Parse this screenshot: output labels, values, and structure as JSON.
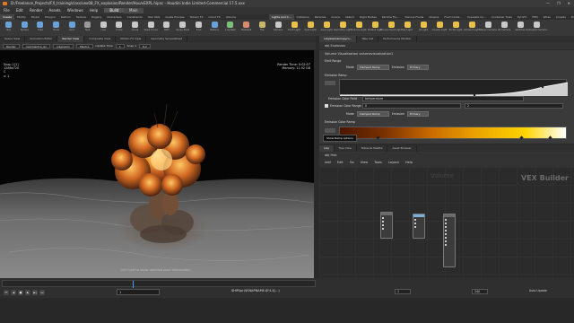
{
  "window": {
    "title": "D:/Freelance_Projects/FX_training/class/vex08_FX_explosion/Render/Hou/vEXPL.hipnc - Houdini Indie Limited-Commercial 17.5.xxx",
    "controls": [
      "—",
      "❐",
      "✕"
    ]
  },
  "menubar": {
    "items": [
      "File",
      "Edit",
      "Render",
      "Assets",
      "Windows",
      "Help"
    ],
    "build": "Build",
    "main": "Main"
  },
  "shelf_left": {
    "tabs": [
      "Create",
      "Modify",
      "Model",
      "Polygon",
      "Deform",
      "Texture",
      "Rigging",
      "Characters",
      "Constraints",
      "Hair Utils",
      "Guide Process",
      "Terrain FX",
      "Cloud FX",
      "Volume"
    ],
    "tools": [
      {
        "label": "Box",
        "color": "#6aa0d8"
      },
      {
        "label": "Sphere",
        "color": "#6aa0d8"
      },
      {
        "label": "Tube",
        "color": "#6aa0d8"
      },
      {
        "label": "Torus",
        "color": "#6aa0d8"
      },
      {
        "label": "Grid",
        "color": "#6aa0d8"
      },
      {
        "label": "Null",
        "color": "#9a9a9a"
      },
      {
        "label": "Line",
        "color": "#c8c8c8"
      },
      {
        "label": "Circle",
        "color": "#c8c8c8"
      },
      {
        "label": "Curve",
        "color": "#c8c8c8"
      },
      {
        "label": "Draw Curve",
        "color": "#c8c8c8"
      },
      {
        "label": "Path",
        "color": "#c8c8c8"
      },
      {
        "label": "Spray Paint",
        "color": "#c8c8c8"
      },
      {
        "label": "Font",
        "color": "#c8c8c8"
      },
      {
        "label": "Platonic",
        "color": "#6aa0d8"
      },
      {
        "label": "L-System",
        "color": "#7cc07c"
      },
      {
        "label": "Metaball",
        "color": "#d88a6a"
      },
      {
        "label": "File",
        "color": "#c8b86a"
      }
    ]
  },
  "shelf_right": {
    "tabs": [
      "Lights and C...",
      "Collisions",
      "Particles",
      "Grains",
      "Vellum",
      "Rigid Bodies",
      "Particle Flu...",
      "Viscous Fluids",
      "Oceans",
      "Fluid Conta...",
      "Populate Co...",
      "Container Tools",
      "PyroFX",
      "FEM",
      "Wires",
      "Crowds",
      "Drive Simu..."
    ],
    "tools": [
      {
        "label": "Camera",
        "color": "#c8c8c8"
      },
      {
        "label": "Point Light",
        "color": "#e8c04a"
      },
      {
        "label": "Spot Light",
        "color": "#e8c04a"
      },
      {
        "label": "Area Light",
        "color": "#e8c04a"
      },
      {
        "label": "Geometry Light",
        "color": "#e8c04a"
      },
      {
        "label": "Volume Light",
        "color": "#e8c04a"
      },
      {
        "label": "Distant Light",
        "color": "#e8c04a"
      },
      {
        "label": "Environment Light",
        "color": "#e8c04a"
      },
      {
        "label": "Sky Light",
        "color": "#e8c04a"
      },
      {
        "label": "GI Light",
        "color": "#e8c04a"
      },
      {
        "label": "Caustic Light",
        "color": "#e8c04a"
      },
      {
        "label": "Portal Light",
        "color": "#e8c04a"
      },
      {
        "label": "Ambient Light",
        "color": "#e8c04a"
      },
      {
        "label": "Stereo Camera",
        "color": "#c8c8c8"
      },
      {
        "label": "VR Camera",
        "color": "#c8c8c8"
      },
      {
        "label": "Switcher",
        "color": "#c8c8c8"
      },
      {
        "label": "Gamepad Camera",
        "color": "#c8c8c8"
      }
    ]
  },
  "viewport": {
    "tabs": [
      "Scene View",
      "Animation Editor",
      "Render View",
      "Composite View",
      "Motion FX View",
      "Geometry Spreadsheet"
    ],
    "active_tab": "Render View",
    "toolbar": {
      "renderer": "Render",
      "target": "/out/mantra_ipr",
      "camera": "/obj/cam1",
      "mode": "Mantra",
      "update_time": "Update Time",
      "update_value": "1",
      "snap": "Snap 1",
      "snap_value": "8.2"
    },
    "info_left": [
      "Snap 1[1]",
      "1286x720",
      "C",
      "x: 1"
    ],
    "info_right": {
      "render_time": "Render Time:  0:02:07",
      "memory": "Memory:       11.92 GB"
    },
    "hint": "Ctrl+Left to show detailed pixel information."
  },
  "playbar": {
    "frame": "1",
    "start": "1",
    "end": "240",
    "status": "$HIP/ipr/$SNAPNAME.$F4.$(...)",
    "auto_update": "Auto Update",
    "fps": "24"
  },
  "params": {
    "tabs": [
      "/obj/explosion/pyro...",
      "Take List",
      "Performance Monitor"
    ],
    "path": "obj  Explosion",
    "node_title": "Volume Visualization   volumevisualization1",
    "smoke_range_label": "Emit Range",
    "mode_label": "Mode",
    "mode_value": "Clamped Ramp",
    "emission_label": "Emission",
    "emission_value": "Primary",
    "emission_ramp_label": "Emission Ramp",
    "color_field_label": "Emission Color Field",
    "color_field_value": "temperature",
    "color_range_label": "Emission Color Range",
    "range_min": "0",
    "range_max": "2",
    "color_mode_label": "Mode",
    "color_mode_value": "Clamped Ramp",
    "color_emission_label": "Emission",
    "color_emission_value": "Primary",
    "color_ramp_label": "Emission Color Ramp",
    "tooltip": "Show Ramp options"
  },
  "network": {
    "tabs": [
      "/obj",
      "Tree View",
      "Material Palette",
      "Asset Browser"
    ],
    "path": "obj  Hub",
    "menu": [
      "Add",
      "Edit",
      "Go",
      "View",
      "Tools",
      "Layout",
      "Help"
    ],
    "watermark": "VEX Builder",
    "ghost_label": "Volume"
  }
}
